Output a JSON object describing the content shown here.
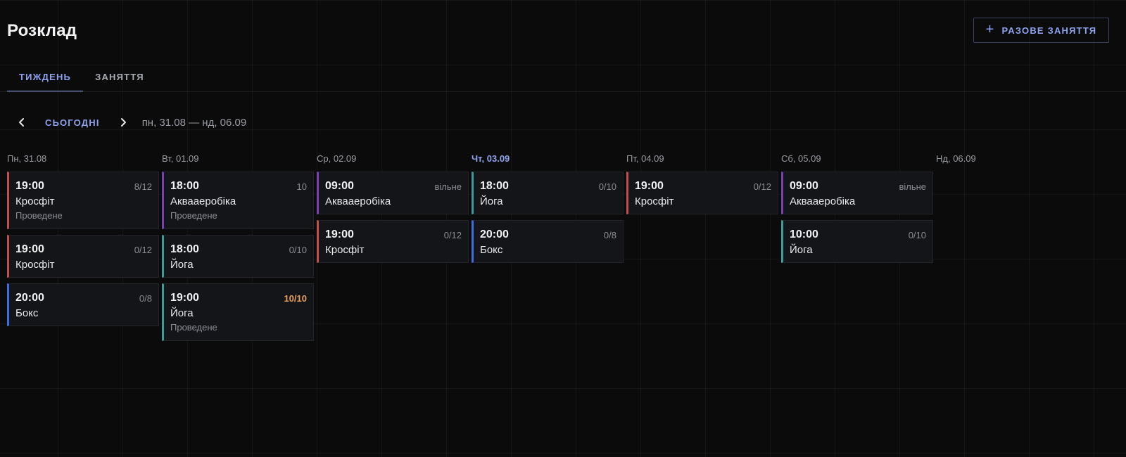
{
  "header": {
    "title": "Розклад",
    "add_button_icon": "plus-icon",
    "add_button_label": "РАЗОВЕ ЗАНЯТТЯ"
  },
  "tabs": [
    {
      "label": "ТИЖДЕНЬ",
      "active": true
    },
    {
      "label": "ЗАНЯТТЯ",
      "active": false
    }
  ],
  "nav": {
    "prev_icon": "chevron-left-icon",
    "today_label": "СЬОГОДНІ",
    "next_icon": "chevron-right-icon",
    "range": "пн, 31.08 — нд, 06.09"
  },
  "colors": {
    "accent": "#8ea2ee",
    "crossfit": "#c0504d",
    "aqua": "#7a3fb0",
    "yoga": "#3f9a9a",
    "box": "#3f6de0",
    "full_capacity": "#e6a25a"
  },
  "days": [
    {
      "label": "Пн, 31.08",
      "today": false,
      "events": [
        {
          "time": "19:00",
          "capacity": "8/12",
          "name": "Кросфіт",
          "status": "Проведене",
          "color": "red"
        },
        {
          "time": "19:00",
          "capacity": "0/12",
          "name": "Кросфіт",
          "status": "",
          "color": "red"
        },
        {
          "time": "20:00",
          "capacity": "0/8",
          "name": "Бокс",
          "status": "",
          "color": "blue"
        }
      ]
    },
    {
      "label": "Вт, 01.09",
      "today": false,
      "events": [
        {
          "time": "18:00",
          "capacity": "10",
          "name": "Аквааеробіка",
          "status": "Проведене",
          "color": "purple"
        },
        {
          "time": "18:00",
          "capacity": "0/10",
          "name": "Йога",
          "status": "",
          "color": "teal"
        },
        {
          "time": "19:00",
          "capacity": "10/10",
          "name": "Йога",
          "status": "Проведене",
          "color": "teal",
          "full": true
        }
      ]
    },
    {
      "label": "Ср, 02.09",
      "today": false,
      "events": [
        {
          "time": "09:00",
          "capacity": "вільне",
          "name": "Аквааеробіка",
          "status": "",
          "color": "purple"
        },
        {
          "time": "19:00",
          "capacity": "0/12",
          "name": "Кросфіт",
          "status": "",
          "color": "red"
        }
      ]
    },
    {
      "label": "Чт, 03.09",
      "today": true,
      "events": [
        {
          "time": "18:00",
          "capacity": "0/10",
          "name": "Йога",
          "status": "",
          "color": "teal"
        },
        {
          "time": "20:00",
          "capacity": "0/8",
          "name": "Бокс",
          "status": "",
          "color": "blue"
        }
      ]
    },
    {
      "label": "Пт, 04.09",
      "today": false,
      "events": [
        {
          "time": "19:00",
          "capacity": "0/12",
          "name": "Кросфіт",
          "status": "",
          "color": "red"
        }
      ]
    },
    {
      "label": "Сб, 05.09",
      "today": false,
      "events": [
        {
          "time": "09:00",
          "capacity": "вільне",
          "name": "Аквааеробіка",
          "status": "",
          "color": "purple"
        },
        {
          "time": "10:00",
          "capacity": "0/10",
          "name": "Йога",
          "status": "",
          "color": "teal"
        }
      ]
    },
    {
      "label": "Нд, 06.09",
      "today": false,
      "events": []
    }
  ]
}
